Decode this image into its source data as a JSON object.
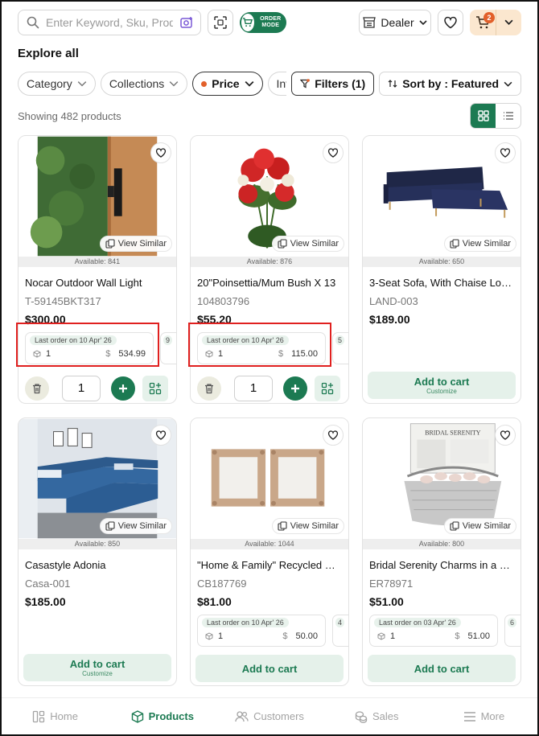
{
  "search": {
    "placeholder": "Enter Keyword, Sku, Produ..."
  },
  "order_mode_label": "ORDER MODE",
  "dealer_label": "Dealer",
  "cart_badge": "2",
  "page_title": "Explore all",
  "filters": {
    "category": "Category",
    "collections": "Collections",
    "price": "Price",
    "inventory": "Inventor",
    "filters": "Filters (1)",
    "sort": "Sort by : Featured"
  },
  "product_count": "Showing 482 products",
  "common": {
    "view_similar": "View Similar",
    "add_to_cart": "Add to cart",
    "customize": "Customize",
    "qty_default": "1"
  },
  "products": [
    {
      "name": "Nocar Outdoor Wall Light",
      "sku": "T-59145BKT317",
      "price": "$300.00",
      "available": "Available: 841",
      "last_order": {
        "label": "Last order on 10 Apr' 26",
        "qty": "1",
        "amount": "534.99"
      }
    },
    {
      "name": "20\"Poinsettia/Mum Bush X 13",
      "sku": "104803796",
      "price": "$55.20",
      "available": "Available: 876",
      "last_order": {
        "label": "Last order on 10 Apr' 26",
        "qty": "1",
        "amount": "115.00"
      }
    },
    {
      "name": "3-Seat Sofa, With Chaise Long...",
      "sku": "LAND-003",
      "price": "$189.00",
      "available": "Available: 650"
    },
    {
      "name": "Casastyle Adonia",
      "sku": "Casa-001",
      "price": "$185.00",
      "available": "Available: 850"
    },
    {
      "name": "\"Home & Family\" Recycled Pap...",
      "sku": "CB187769",
      "price": "$81.00",
      "available": "Available: 1044",
      "last_order": {
        "label": "Last order on 10 Apr' 26",
        "qty": "1",
        "amount": "50.00"
      }
    },
    {
      "name": "Bridal Serenity Charms in a Ba...",
      "sku": "ER78971",
      "price": "$51.00",
      "available": "Available: 800",
      "last_order": {
        "label": "Last order on 03 Apr' 26",
        "qty": "1",
        "amount": "51.00"
      },
      "image_text": "BRIDAL SERENITY"
    }
  ],
  "ghost_label_fragments": [
    "9",
    "5",
    "4",
    "6"
  ],
  "currency_symbol": "$",
  "nav": {
    "home": "Home",
    "products": "Products",
    "customers": "Customers",
    "sales": "Sales",
    "more": "More"
  },
  "colors": {
    "brand_green": "#1c7a52",
    "highlight_red": "#e0201f",
    "cart_bg": "#fbe7cf",
    "badge": "#e2602a"
  }
}
